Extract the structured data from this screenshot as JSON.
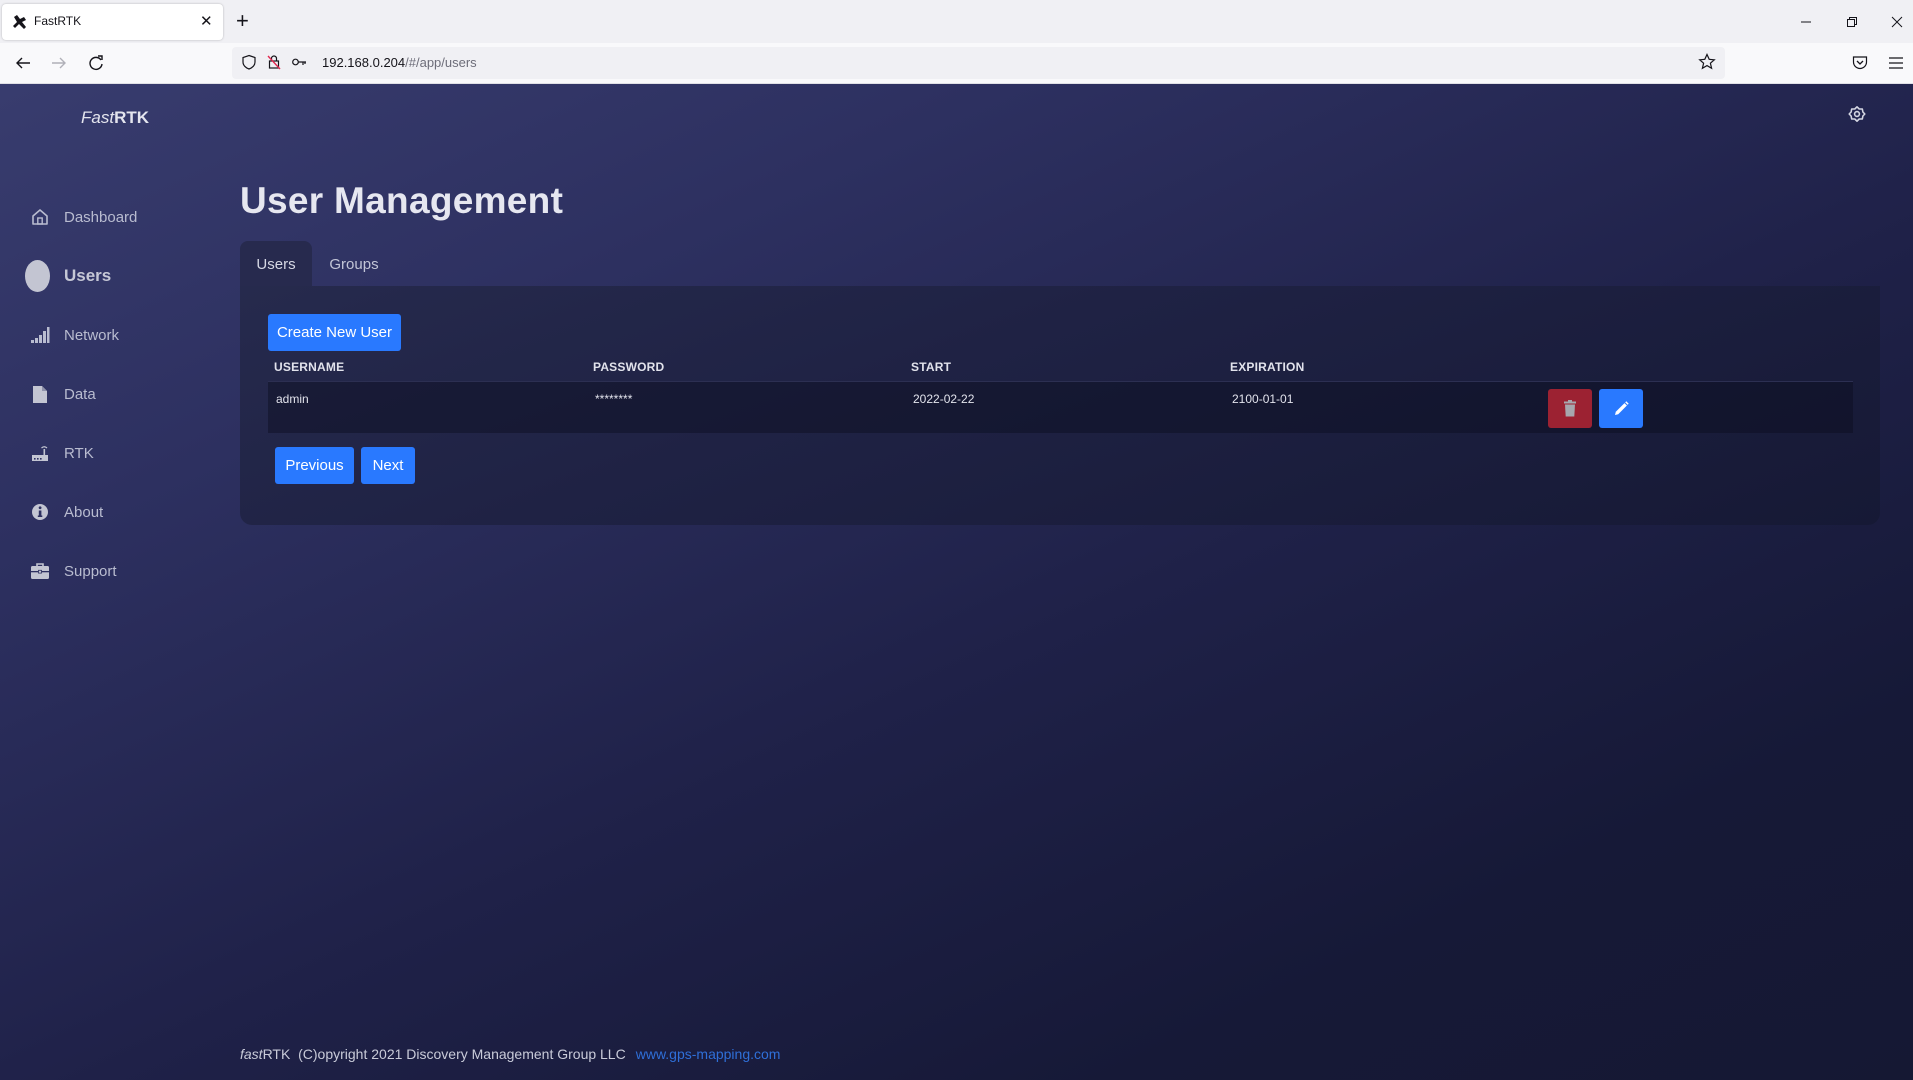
{
  "browser": {
    "tab_title": "FastRTK",
    "url_host": "192.168.0.204",
    "url_path": "/#/app/users",
    "new_tab_label": "+",
    "close_tab_label": "✕"
  },
  "app": {
    "brand_italic": "Fast",
    "brand_bold": "RTK"
  },
  "sidebar": {
    "items": [
      {
        "label": "Dashboard",
        "icon": "home-icon",
        "active": false
      },
      {
        "label": "Users",
        "icon": "active-indicator",
        "active": true
      },
      {
        "label": "Network",
        "icon": "signal-bars-icon",
        "active": false
      },
      {
        "label": "Data",
        "icon": "file-icon",
        "active": false
      },
      {
        "label": "RTK",
        "icon": "router-icon",
        "active": false
      },
      {
        "label": "About",
        "icon": "info-icon",
        "active": false
      },
      {
        "label": "Support",
        "icon": "briefcase-icon",
        "active": false
      }
    ]
  },
  "main": {
    "title": "User Management",
    "tabs": [
      {
        "label": "Users",
        "active": true
      },
      {
        "label": "Groups",
        "active": false
      }
    ],
    "create_button": "Create New User",
    "table": {
      "columns": [
        "USERNAME",
        "PASSWORD",
        "START",
        "EXPIRATION"
      ],
      "rows": [
        {
          "username": "admin",
          "password": "********",
          "start": "2022-02-22",
          "expiration": "2100-01-01"
        }
      ]
    },
    "pagination": {
      "previous": "Previous",
      "next": "Next"
    }
  },
  "footer": {
    "brand_italic": "fast",
    "brand_rest": "RTK",
    "copyright": "(C)opyright 2021 Discovery Management Group LLC",
    "link": "www.gps-mapping.com"
  },
  "colors": {
    "primary": "#2979ff",
    "danger": "#9c2232",
    "link": "#2f6fd8"
  }
}
